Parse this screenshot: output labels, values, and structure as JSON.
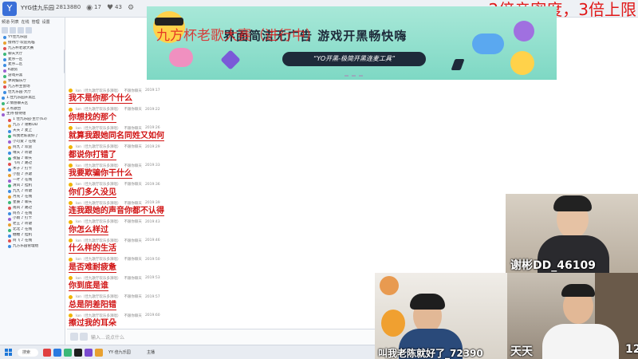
{
  "topbar": {
    "room_title": "YYG佳九乐园",
    "room_id": "2813880",
    "stat_online": "17",
    "stat_fans": "43",
    "overlay_text": "2倍亲密度，3倍上限"
  },
  "banner": {
    "title": "界面简洁无广告 游戏开黑畅快嗨",
    "tagline": "“YO开黑-极简开黑连麦工具”",
    "competition_overlay": "九方杯老歌大赛（进行中）"
  },
  "sidebar": {
    "header": [
      "频道·列表",
      "在线",
      "管理",
      "设置"
    ],
    "rows": [
      {
        "text": "YY佳九乐园",
        "color": "#3c8ce0"
      },
      {
        "text": "接待厅·欢迎光临",
        "color": "#e8a030"
      },
      {
        "text": "九方杯老歌大赛",
        "color": "#e05050"
      },
      {
        "text": "聊天大厅",
        "color": "#3cb878"
      },
      {
        "text": "麦序一区",
        "color": "#3c8ce0"
      },
      {
        "text": "麦序二区",
        "color": "#3c8ce0"
      },
      {
        "text": "K歌房",
        "color": "#9a60d0"
      },
      {
        "text": "游戏开黑",
        "color": "#3cb878"
      },
      {
        "text": "休闲娱乐厅",
        "color": "#e8a030"
      },
      {
        "text": "九方杯主会场",
        "color": "#e05050"
      },
      {
        "text": "佳九乐园·大厅",
        "color": "#3c8ce0"
      },
      {
        "text": "1.佳九乐园开黑区",
        "color": "#3c8ce0"
      },
      {
        "text": "2.情感聊天区",
        "color": "#3cb878"
      },
      {
        "text": "3.点歌台",
        "color": "#e8a030"
      },
      {
        "text": "主持·接待组",
        "color": "#9a60d0"
      },
      {
        "text": "1 佳九乐园·主厅(63)",
        "color": "#e05050"
      },
      {
        "text": "九方 ♪ 谢彬DD",
        "color": "#e8a030"
      },
      {
        "text": "天天 ♪ 麦上",
        "color": "#3c8ce0"
      },
      {
        "text": "叫我老陈就好了",
        "color": "#3cb878"
      },
      {
        "text": "小可爱 ♪ 在线",
        "color": "#9a60d0"
      },
      {
        "text": "阿九 ♪ 欢迎",
        "color": "#e8a030"
      },
      {
        "text": "晴天 ♪ 听歌",
        "color": "#3c8ce0"
      },
      {
        "text": "夜猫 ♪ 聊天",
        "color": "#3cb878"
      },
      {
        "text": "飞鸟 ♪ 路过",
        "color": "#e05050"
      },
      {
        "text": "木子 ♪ 打卡",
        "color": "#3c8ce0"
      },
      {
        "text": "小鱼 ♪ 点歌",
        "color": "#e8a030"
      },
      {
        "text": "一叶 ♪ 在线",
        "color": "#9a60d0"
      },
      {
        "text": "清风 ♪ 挂机",
        "color": "#3cb878"
      },
      {
        "text": "九九 ♪ 听歌",
        "color": "#3c8ce0"
      },
      {
        "text": "月光 ♪ 在线",
        "color": "#e8a030"
      },
      {
        "text": "星辰 ♪ 聊天",
        "color": "#3cb878"
      },
      {
        "text": "南风 ♪ 路过",
        "color": "#e05050"
      },
      {
        "text": "阿杰 ♪ 在线",
        "color": "#3c8ce0"
      },
      {
        "text": "小雨 ♪ 打卡",
        "color": "#9a60d0"
      },
      {
        "text": "老王 ♪ 听歌",
        "color": "#e8a030"
      },
      {
        "text": "北北 ♪ 在线",
        "color": "#3cb878"
      },
      {
        "text": "糖糖 ♪ 挂机",
        "color": "#3c8ce0"
      },
      {
        "text": "阿飞 ♪ 在线",
        "color": "#e05050"
      },
      {
        "text": "九方乐园管理组",
        "color": "#3c8ce0"
      }
    ]
  },
  "chat": {
    "meta_user": "Ion（佳九歌厅欢乐多演唱）",
    "meta_tag": "不跟你聊天",
    "messages": [
      {
        "text": "我不是你那个什么",
        "time": "2019:17"
      },
      {
        "text": "你想找的那个",
        "time": "2019:22"
      },
      {
        "text": "就算我跟她同名同姓又如何",
        "time": "2019:26"
      },
      {
        "text": "都说你打错了",
        "time": "2019:29"
      },
      {
        "text": "我要欺骗你干什么",
        "time": "2019:33"
      },
      {
        "text": "你们多久没见",
        "time": "2019:36"
      },
      {
        "text": "连我跟她的声音你都不认得",
        "time": "2019:39"
      },
      {
        "text": "你怎么样过",
        "time": "2019:43"
      },
      {
        "text": "什么样的生活",
        "time": "2019:46"
      },
      {
        "text": "是否难耐疲惫",
        "time": "2019:50"
      },
      {
        "text": "你到底是谁",
        "time": "2019:53"
      },
      {
        "text": "总是阴差阳错",
        "time": "2019:57"
      },
      {
        "text": "擦过我的耳朵",
        "time": "2019:60"
      }
    ],
    "input_placeholder": "输入…说点什么"
  },
  "taskbar": {
    "search_label": "搜索",
    "apps": [
      "#e04040",
      "#2a7ae0",
      "#3cb878",
      "#1e1e1e",
      "#7a4ad0",
      "#e8a030"
    ],
    "label_1": "YY·佳九乐园",
    "label_2": "主播"
  },
  "videos": {
    "cam1_label": "谢彬DD_46109",
    "cam2_label": "叫我老陈就好了_72390",
    "cam3_label": "天天",
    "cam3_suffix": "12"
  }
}
